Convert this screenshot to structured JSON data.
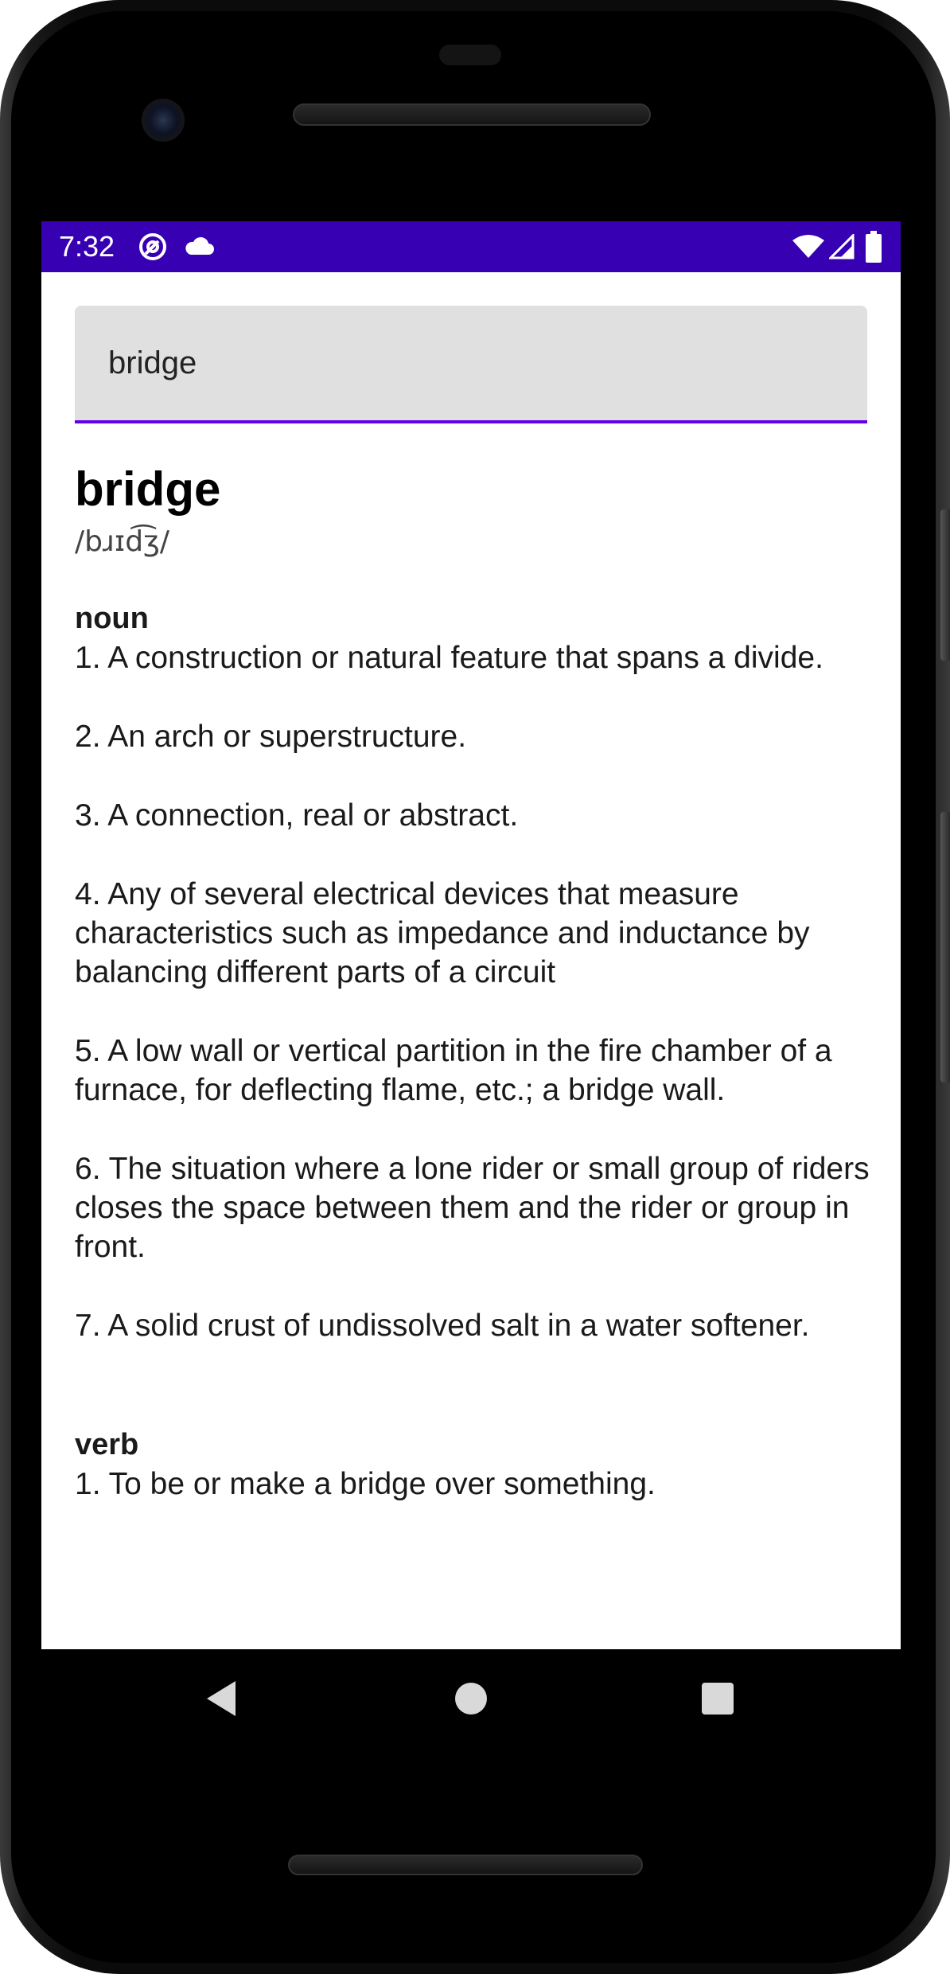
{
  "status_bar": {
    "time": "7:32",
    "left_icons": [
      "at-sign-icon",
      "cloud-icon"
    ],
    "right_icons": [
      "wifi-icon",
      "signal-icon",
      "battery-icon"
    ],
    "color": "#3700b3"
  },
  "search": {
    "value": "bridge",
    "accent": "#6200ee"
  },
  "entry": {
    "word": "bridge",
    "phonetic": "/bɹɪd͡ʒ/",
    "meanings": [
      {
        "part_of_speech": "noun",
        "definitions": [
          "1. A construction or natural feature that spans a divide.",
          "2. An arch or superstructure.",
          "3. A connection, real or abstract.",
          "4. Any of several electrical devices that measure characteristics such as impedance and inductance by balancing different parts of a circuit",
          "5. A low wall or vertical partition in the fire chamber of a furnace, for deflecting flame, etc.; a bridge wall.",
          "6. The situation where a lone rider or small group of riders closes the space between them and the rider or group in front.",
          "7. A solid crust of undissolved salt in a water softener."
        ]
      },
      {
        "part_of_speech": "verb",
        "definitions": [
          "1. To be or make a bridge over something."
        ]
      }
    ]
  },
  "nav": {
    "buttons": [
      "back-icon",
      "home-icon",
      "recents-icon"
    ]
  }
}
